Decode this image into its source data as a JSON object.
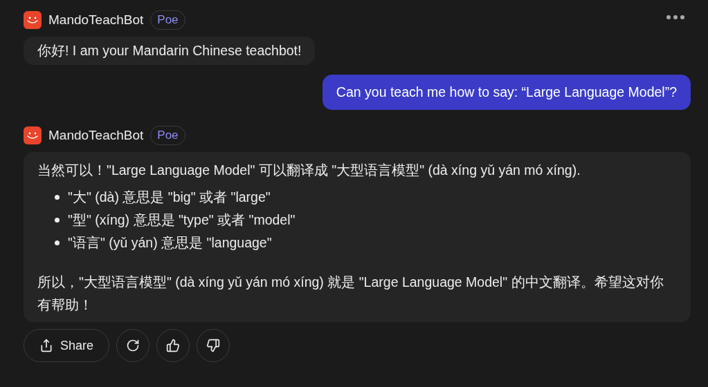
{
  "messages": [
    {
      "kind": "bot",
      "sender": "MandoTeachBot",
      "badge": "Poe",
      "blocks": [
        {
          "kind": "paragraph",
          "text": "你好! I am your Mandarin Chinese teachbot!"
        }
      ]
    },
    {
      "kind": "user",
      "text": "Can you teach me how to say: “Large Language Model”?"
    },
    {
      "kind": "bot",
      "sender": "MandoTeachBot",
      "badge": "Poe",
      "blocks": [
        {
          "kind": "paragraph",
          "text": "当然可以！\"Large Language Model\" 可以翻译成 \"大型语言模型\" (dà xíng yǔ yán mó xíng)."
        },
        {
          "kind": "list",
          "items": [
            "\"大\" (dà) 意思是 \"big\" 或者 \"large\"",
            "\"型\" (xíng) 意思是 \"type\" 或者 \"model\"",
            "\"语言\" (yǔ yán) 意思是 \"language\""
          ]
        },
        {
          "kind": "paragraph",
          "text": "所以，\"大型语言模型\" (dà xíng yǔ yán mó xíng) 就是 \"Large Language Model\" 的中文翻译。希望这对你有帮助！"
        }
      ]
    }
  ],
  "actions": {
    "share_label": "Share"
  }
}
